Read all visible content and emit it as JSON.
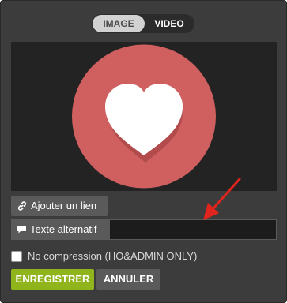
{
  "toggle": {
    "image_label": "IMAGE",
    "video_label": "VIDEO",
    "selected": "IMAGE"
  },
  "preview": {
    "image": "heart-icon",
    "circle_color": "#d06060",
    "heart_color": "#ffffff"
  },
  "actions": {
    "add_link_label": "Ajouter un lien",
    "alt_text_label": "Texte alternatif",
    "alt_text_value": "",
    "no_compression_label": "No compression (HO&ADMIN ONLY)",
    "no_compression_checked": false,
    "save_label": "ENREGISTRER",
    "cancel_label": "ANNULER"
  },
  "colors": {
    "accent": "#8fb41c",
    "arrow": "#e0241e"
  }
}
